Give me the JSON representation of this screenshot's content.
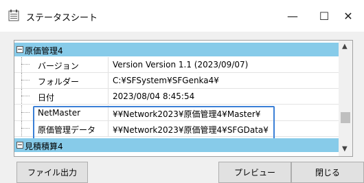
{
  "window": {
    "title": "ステータスシート",
    "min": "—",
    "max": "☐",
    "close": "✕"
  },
  "tree": {
    "category1": "原価管理4",
    "rows": [
      {
        "name": "バージョン",
        "value": "Version Version 1.1 (2023/09/07)"
      },
      {
        "name": "フォルダー",
        "value": "C:¥SFSystem¥SFGenka4¥"
      },
      {
        "name": "日付",
        "value": "2023/08/04 8:45:54"
      },
      {
        "name": "NetMaster",
        "value": "¥¥Network2023¥原価管理4¥Master¥"
      },
      {
        "name": "原価管理データ",
        "value": "¥¥Network2023¥原価管理4¥SFGData¥"
      }
    ],
    "category2": "見積積算4"
  },
  "scroll": {
    "up": "▲",
    "down": "▼"
  },
  "buttons": {
    "export": "ファイル出力",
    "preview": "プレビュー",
    "close": "閉じる"
  }
}
